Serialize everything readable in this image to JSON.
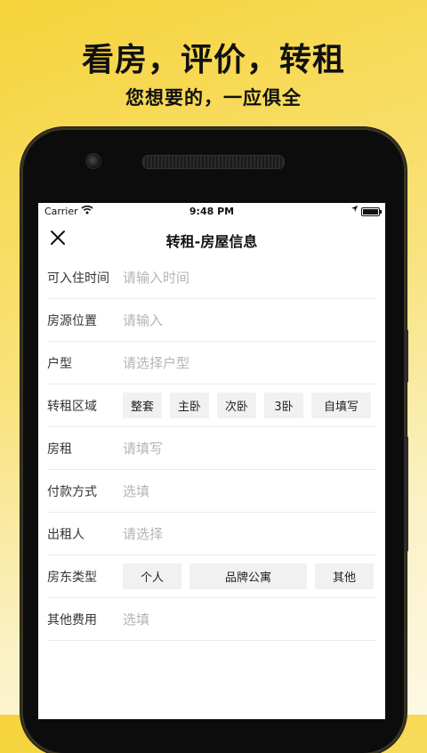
{
  "promo": {
    "headline": "看房，评价，转租",
    "subline": "您想要的，一应俱全"
  },
  "status_bar": {
    "carrier": "Carrier",
    "time": "9:48 PM"
  },
  "nav": {
    "title": "转租-房屋信息",
    "close_icon": "close-icon"
  },
  "form": {
    "move_in_time": {
      "label": "可入住时间",
      "placeholder": "请输入时间"
    },
    "location": {
      "label": "房源位置",
      "placeholder": "请输入"
    },
    "layout": {
      "label": "户型",
      "placeholder": "请选择户型"
    },
    "sublet_area": {
      "label": "转租区域",
      "options": [
        "整套",
        "主卧",
        "次卧",
        "3卧",
        "自填写"
      ]
    },
    "rent": {
      "label": "房租",
      "placeholder": "请填写"
    },
    "payment": {
      "label": "付款方式",
      "placeholder": "选填"
    },
    "lessor": {
      "label": "出租人",
      "placeholder": "请选择"
    },
    "landlord_type": {
      "label": "房东类型",
      "options": [
        "个人",
        "品牌公寓",
        "其他"
      ]
    },
    "other_fees": {
      "label": "其他费用",
      "placeholder": "选填"
    }
  },
  "colors": {
    "background_gradient_start": "#f6d33a",
    "background_gradient_end": "#fdf8e4",
    "chip_bg": "#f1f1f1",
    "placeholder": "#b4b4b4"
  }
}
